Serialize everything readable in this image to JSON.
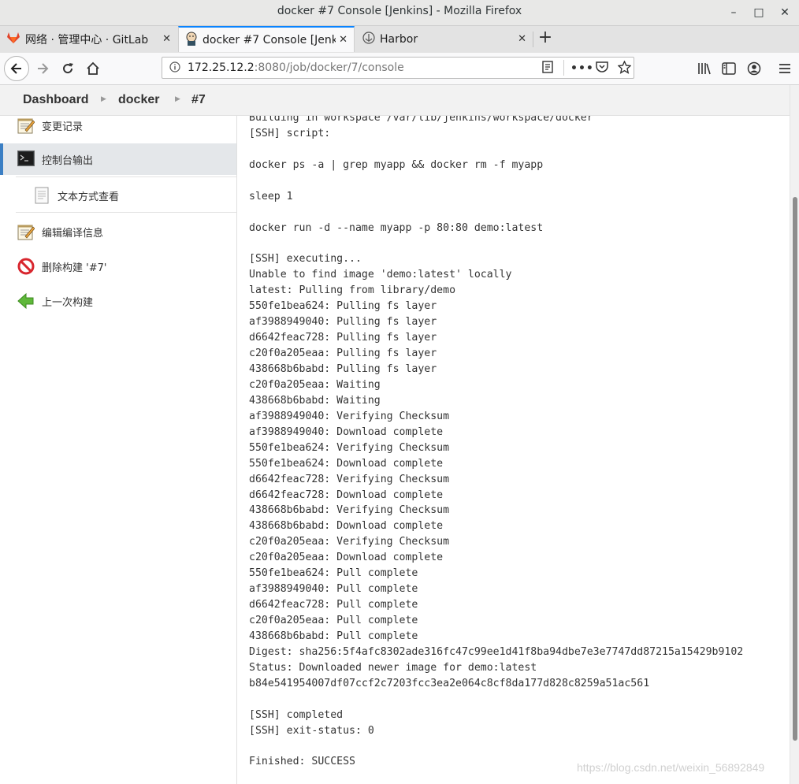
{
  "window": {
    "title": "docker #7 Console [Jenkins] - Mozilla Firefox",
    "minimize": "–",
    "maximize": "□",
    "close": "✕"
  },
  "tabs": [
    {
      "label": "网络 · 管理中心 · GitLab",
      "icon": "gitlab-icon",
      "close": "✕"
    },
    {
      "label": "docker #7 Console [Jenkins]",
      "icon": "jenkins-icon",
      "close": "✕"
    },
    {
      "label": "Harbor",
      "icon": "harbor-icon",
      "close": "✕"
    }
  ],
  "new_tab": "+",
  "navbar": {
    "url_host": "172.25.12.2",
    "url_path": ":8080/job/docker/7/console",
    "more": "•••"
  },
  "breadcrumb": [
    "Dashboard",
    "docker",
    "#7"
  ],
  "sidebar": [
    {
      "label": "变更记录",
      "icon": "notepad-icon"
    },
    {
      "label": "控制台输出",
      "icon": "terminal-icon"
    },
    {
      "label": "文本方式查看",
      "icon": "document-icon"
    },
    {
      "label": "编辑编译信息",
      "icon": "notepad-icon"
    },
    {
      "label": "删除构建 '#7'",
      "icon": "no-entry-icon"
    },
    {
      "label": "上一次构建",
      "icon": "arrow-left-icon"
    }
  ],
  "console_text": "Building in workspace /var/lib/jenkins/workspace/docker\n[SSH] script:\n\ndocker ps -a | grep myapp && docker rm -f myapp\n\nsleep 1\n\ndocker run -d --name myapp -p 80:80 demo:latest\n\n[SSH] executing...\nUnable to find image 'demo:latest' locally\nlatest: Pulling from library/demo\n550fe1bea624: Pulling fs layer\naf3988949040: Pulling fs layer\nd6642feac728: Pulling fs layer\nc20f0a205eaa: Pulling fs layer\n438668b6babd: Pulling fs layer\nc20f0a205eaa: Waiting\n438668b6babd: Waiting\naf3988949040: Verifying Checksum\naf3988949040: Download complete\n550fe1bea624: Verifying Checksum\n550fe1bea624: Download complete\nd6642feac728: Verifying Checksum\nd6642feac728: Download complete\n438668b6babd: Verifying Checksum\n438668b6babd: Download complete\nc20f0a205eaa: Verifying Checksum\nc20f0a205eaa: Download complete\n550fe1bea624: Pull complete\naf3988949040: Pull complete\nd6642feac728: Pull complete\nc20f0a205eaa: Pull complete\n438668b6babd: Pull complete\nDigest: sha256:5f4afc8302ade316fc47c99ee1d41f8ba94dbe7e3e7747dd87215a15429b9102\nStatus: Downloaded newer image for demo:latest\nb84e541954007df07ccf2c7203fcc3ea2e064c8cf8da177d828c8259a51ac561\n\n[SSH] completed\n[SSH] exit-status: 0\n\nFinished: SUCCESS",
  "watermark": "https://blog.csdn.net/weixin_56892849",
  "colors": {
    "accent": "#0a84ff",
    "sidebar_active": "#e4e7ea",
    "sidebar_border": "#3b7fc4"
  }
}
